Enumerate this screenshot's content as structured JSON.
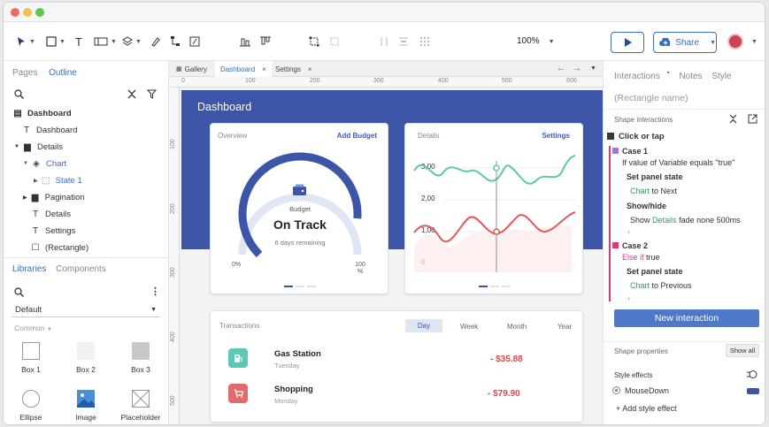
{
  "toolbar": {
    "zoom": "100%",
    "share_label": "Share"
  },
  "left_panel": {
    "tabs": [
      "Pages",
      "Outline"
    ],
    "tree": [
      {
        "label": "Dashboard",
        "bold": true
      },
      {
        "label": "Dashboard"
      },
      {
        "label": "Details"
      },
      {
        "label": "Chart"
      },
      {
        "label": "State 1"
      },
      {
        "label": "Pagination"
      },
      {
        "label": "Details"
      },
      {
        "label": "Settings"
      },
      {
        "label": "(Rectangle)"
      }
    ],
    "lib_tabs": [
      "Libraries",
      "Components"
    ],
    "library_select": "Default",
    "section_label": "Common",
    "components": [
      "Box 1",
      "Box 2",
      "Box 3",
      "Ellipse",
      "Image",
      "Placeholder"
    ]
  },
  "canvas": {
    "tabs": [
      "Gallery",
      "Dashboard",
      "Settings"
    ],
    "ruler_h": [
      "0",
      "100",
      "200",
      "300",
      "400",
      "500",
      "600"
    ],
    "ruler_v": [
      "100",
      "200",
      "300",
      "400",
      "500"
    ],
    "dashboard_title": "Dashboard",
    "overview": {
      "label": "Overview",
      "link": "Add Budget",
      "budget_label": "Budget",
      "status": "On Track",
      "remaining": "6 days remaining",
      "min": "0%",
      "max": "100 %",
      "progress": 0.85
    },
    "details": {
      "label": "Details",
      "link": "Settings",
      "y_ticks": [
        "3,00",
        "2,00",
        "1,00",
        "0"
      ]
    },
    "transactions": {
      "label": "Transactions",
      "periods": [
        "Day",
        "Week",
        "Month",
        "Year"
      ],
      "rows": [
        {
          "name": "Gas Station",
          "day": "Tuesday",
          "amount": "- $35.88"
        },
        {
          "name": "Shopping",
          "day": "Monday",
          "amount": "- $79.90"
        }
      ]
    }
  },
  "right_panel": {
    "tabs": [
      "Interactions",
      "Notes",
      "Style"
    ],
    "name_placeholder": "(Rectangle name)",
    "shape_interactions": "Shape interactions",
    "event": "Click or tap",
    "case1": "Case 1",
    "case1_cond": "If value of Variable equals \"true\"",
    "action1": "Set panel state",
    "action1_target": "Chart",
    "action1_rest": "to Next",
    "action2": "Show/hide",
    "action2_pre": "Show",
    "action2_target": "Details",
    "action2_rest": "fade none 500ms",
    "case2": "Case 2",
    "case2_else": "Else if",
    "case2_true": "true",
    "action3": "Set panel state",
    "action3_target": "Chart",
    "action3_rest": "to Previous",
    "plus": "+",
    "new_interaction": "New interaction",
    "shape_properties": "Shape properties",
    "show_all": "Show all",
    "style_effects": "Style effects",
    "mousedown": "MouseDown",
    "add_style_effect": "+ Add style effect"
  },
  "colors": {
    "accent": "#3a6cc6",
    "dashboard": "#3c55a6",
    "negative": "#e0474c",
    "teal": "#5ec7b6",
    "red": "#e05a5a"
  }
}
